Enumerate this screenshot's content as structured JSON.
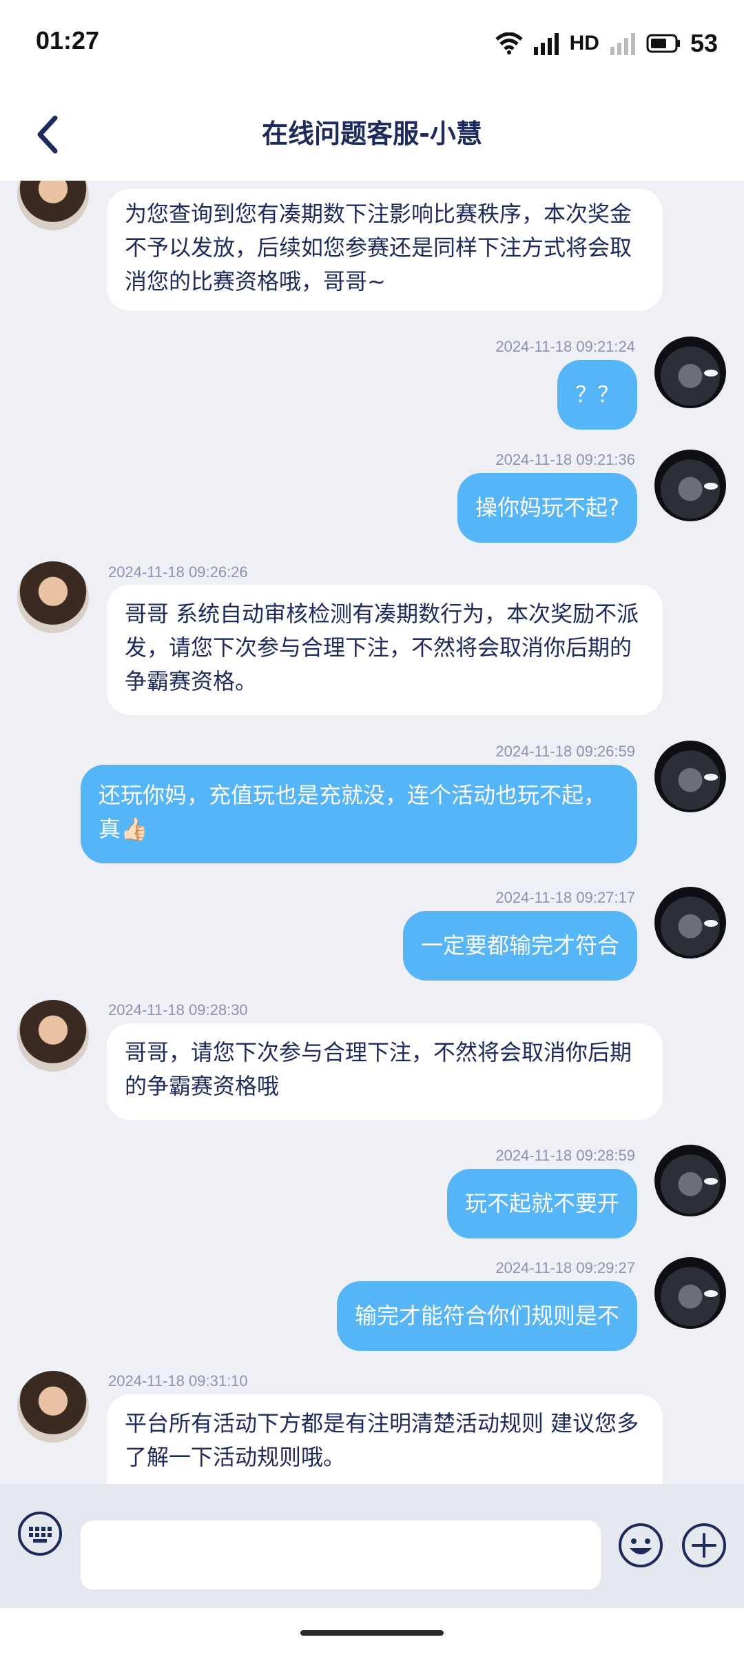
{
  "status_bar": {
    "time": "01:27",
    "network": "HD",
    "battery": "53"
  },
  "header": {
    "title": "在线问题客服-小慧"
  },
  "messages": [
    {
      "sender": "agent",
      "time": "",
      "text": "为您查询到您有凑期数下注影响比赛秩序，本次奖金不予以发放，后续如您参赛还是同样下注方式将会取消您的比赛资格哦，哥哥~"
    },
    {
      "sender": "user",
      "time": "2024-11-18 09:21:24",
      "text": "？？"
    },
    {
      "sender": "user",
      "time": "2024-11-18 09:21:36",
      "text": "操你妈玩不起?"
    },
    {
      "sender": "agent",
      "time": "2024-11-18 09:26:26",
      "text": "哥哥 系统自动审核检测有凑期数行为，本次奖励不派发，请您下次参与合理下注，不然将会取消你后期的争霸赛资格。"
    },
    {
      "sender": "user",
      "time": "2024-11-18 09:26:59",
      "text": "还玩你妈，充值玩也是充就没，连个活动也玩不起，真👍🏻"
    },
    {
      "sender": "user",
      "time": "2024-11-18 09:27:17",
      "text": "一定要都输完才符合"
    },
    {
      "sender": "agent",
      "time": "2024-11-18 09:28:30",
      "text": "哥哥，请您下次参与合理下注，不然将会取消你后期的争霸赛资格哦"
    },
    {
      "sender": "user",
      "time": "2024-11-18 09:28:59",
      "text": "玩不起就不要开"
    },
    {
      "sender": "user",
      "time": "2024-11-18 09:29:27",
      "text": "输完才能符合你们规则是不"
    },
    {
      "sender": "agent",
      "time": "2024-11-18 09:31:10",
      "text": "平台所有活动下方都是有注明清楚活动规则 建议您多了解一下活动规则哦。"
    }
  ],
  "input": {
    "placeholder": ""
  },
  "colors": {
    "user_bubble": "#55b5f7",
    "agent_bubble": "#ffffff",
    "background": "#eef0f5",
    "title": "#1f2a5c"
  },
  "icons": [
    "back-arrow-icon",
    "keyboard-icon",
    "emoji-icon",
    "plus-icon",
    "wifi-icon",
    "signal-icon",
    "battery-icon"
  ]
}
